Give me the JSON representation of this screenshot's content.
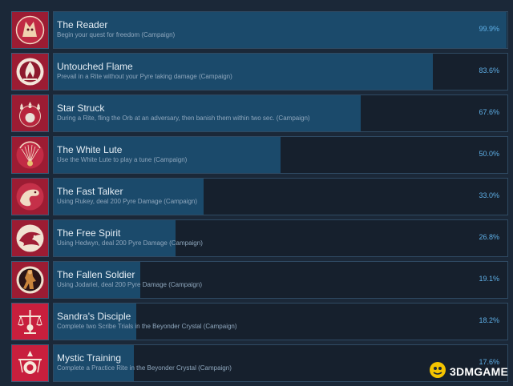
{
  "achievements": [
    {
      "name": "The Reader",
      "description": "Begin your quest for freedom (Campaign)",
      "percent_label": "99.9%",
      "percent": 99.9,
      "icon": "fox-head-icon"
    },
    {
      "name": "Untouched Flame",
      "description": "Prevail in a Rite without your Pyre taking damage (Campaign)",
      "percent_label": "83.6%",
      "percent": 83.6,
      "icon": "flame-icon"
    },
    {
      "name": "Star Struck",
      "description": "During a Rite, fling the Orb at an adversary, then banish them within two sec. (Campaign)",
      "percent_label": "67.6%",
      "percent": 67.6,
      "icon": "star-orb-icon"
    },
    {
      "name": "The White Lute",
      "description": "Use the White Lute to play a tune (Campaign)",
      "percent_label": "50.0%",
      "percent": 50.0,
      "icon": "lute-icon"
    },
    {
      "name": "The Fast Talker",
      "description": "Using Rukey, deal 200 Pyre Damage (Campaign)",
      "percent_label": "33.0%",
      "percent": 33.0,
      "icon": "dog-icon"
    },
    {
      "name": "The Free Spirit",
      "description": "Using Hedwyn, deal 200 Pyre Damage (Campaign)",
      "percent_label": "26.8%",
      "percent": 26.8,
      "icon": "bird-icon"
    },
    {
      "name": "The Fallen Soldier",
      "description": "Using Jodariel, deal 200 Pyre Damage (Campaign)",
      "percent_label": "19.1%",
      "percent": 19.1,
      "icon": "soldier-icon"
    },
    {
      "name": "Sandra's Disciple",
      "description": "Complete two Scribe Trials in the Beyonder Crystal (Campaign)",
      "percent_label": "18.2%",
      "percent": 18.2,
      "icon": "scales-icon"
    },
    {
      "name": "Mystic Training",
      "description": "Complete a Practice Rite in the Beyonder Crystal (Campaign)",
      "percent_label": "17.6%",
      "percent": 17.6,
      "icon": "mystic-icon"
    }
  ],
  "watermark": {
    "text": "3DMGAME"
  },
  "colors": {
    "bar": "#1b4a6b",
    "panel": "#16202d",
    "background": "#1b2838",
    "percent": "#5fb0e8",
    "icon_red": "#8b1a2e"
  }
}
